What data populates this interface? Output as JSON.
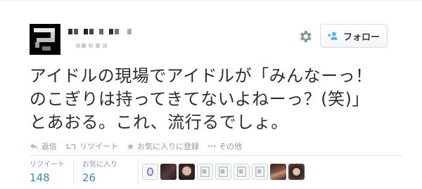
{
  "tweet": {
    "text_line1": "アイドルの現場でアイドルが「みんなーっ！",
    "text_line2": "のこぎりは持ってきてないよねーっ？(笑)」",
    "text_line3": "とあおる。これ、流行るでしょ。"
  },
  "header": {
    "follow_label": "フォロー",
    "settings_icon": "gear-icon",
    "follow_icon": "person-add-icon"
  },
  "actions": [
    {
      "label": "返信",
      "icon": "reply-icon"
    },
    {
      "label": "リツイート",
      "icon": "retweet-icon"
    },
    {
      "label": "お気に入りに登録",
      "icon": "star-icon"
    },
    {
      "label": "その他",
      "icon": "more-icon"
    }
  ],
  "stats": {
    "retweets_label": "リツイート",
    "retweets_count": "148",
    "favorites_label": "お気に入り",
    "favorites_count": "26"
  },
  "colors": {
    "text": "#292f33",
    "muted": "#8899a6",
    "link": "#3b88c3",
    "border": "#e1e8ed"
  }
}
